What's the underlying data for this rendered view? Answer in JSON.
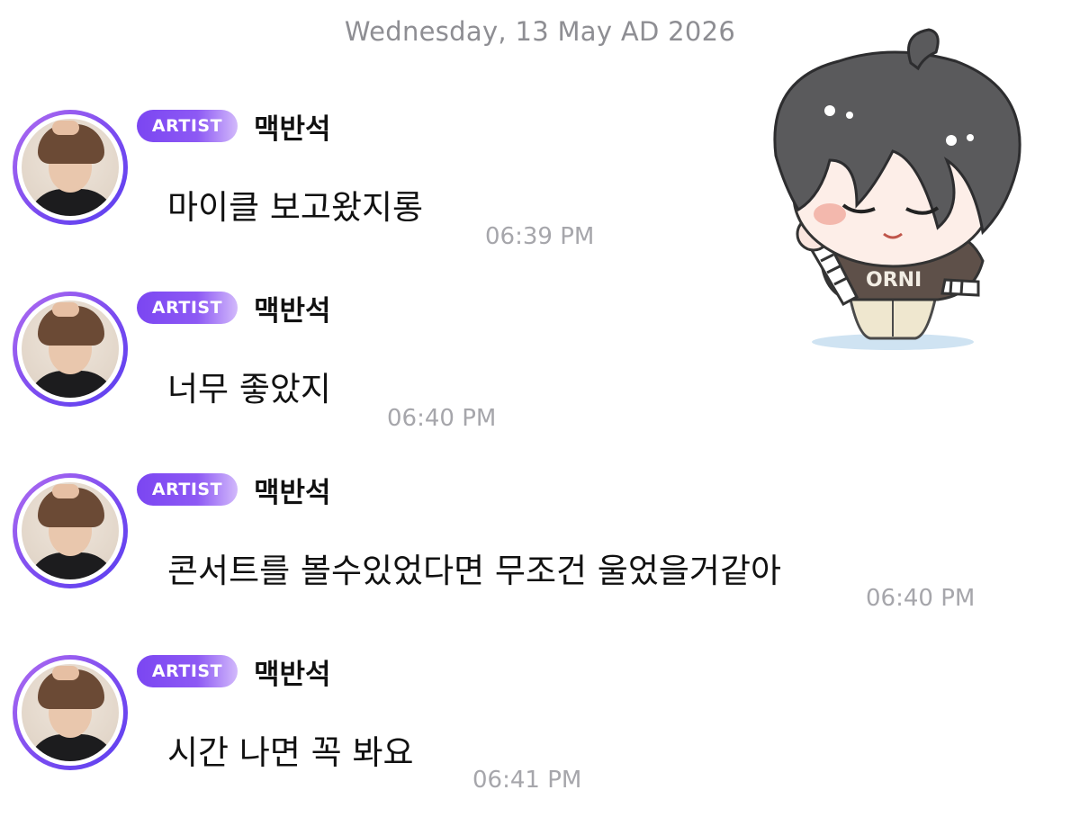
{
  "date_header": "Wednesday, 13 May AD 2026",
  "messages": [
    {
      "badge": "ARTIST",
      "sender": "맥반석",
      "text": "마이클 보고왔지롱",
      "time": "06:39 PM"
    },
    {
      "badge": "ARTIST",
      "sender": "맥반석",
      "text": "너무 좋았지",
      "time": "06:40 PM"
    },
    {
      "badge": "ARTIST",
      "sender": "맥반석",
      "text": "콘서트를 볼수있었다면 무조건 울었을거같아",
      "time": "06:40 PM"
    },
    {
      "badge": "ARTIST",
      "sender": "맥반석",
      "text": "시간 나면 꼭 봐요",
      "time": "06:41 PM"
    }
  ],
  "sticker": {
    "shirt_text": "ORNI",
    "icon": "chibi-character-sticker"
  },
  "colors": {
    "badge_start": "#7b46f2",
    "badge_end": "#d2b9fb",
    "time": "#a6a6ab",
    "date": "#8e8e93"
  }
}
